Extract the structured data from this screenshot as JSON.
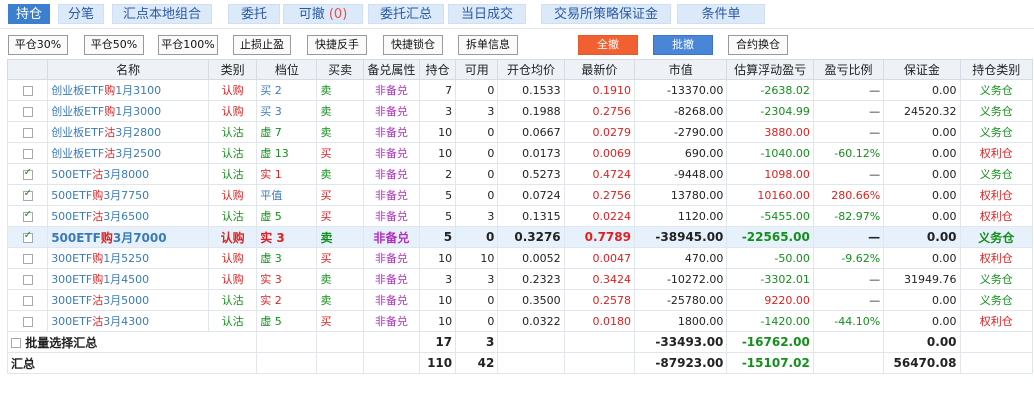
{
  "tabs": [
    {
      "label": "持仓",
      "active": true
    },
    {
      "label": "分笔"
    },
    {
      "label": "汇点本地组合"
    },
    {
      "label": "委托"
    },
    {
      "label": "可撤",
      "count": "(0)"
    },
    {
      "label": "委托汇总"
    },
    {
      "label": "当日成交"
    },
    {
      "label": "交易所策略保证金"
    },
    {
      "label": "条件单"
    }
  ],
  "toolbar": [
    "平仓30%",
    "平仓50%",
    "平仓100%",
    "止损止盈",
    "快捷反手",
    "快捷锁仓",
    "拆单信息",
    "全撤",
    "批撤",
    "合约换仓"
  ],
  "columns": [
    "名称",
    "类别",
    "档位",
    "买卖",
    "备兑属性",
    "持仓",
    "可用",
    "开仓均价",
    "最新价",
    "市值",
    "估算浮动盈亏",
    "盈亏比例",
    "保证金",
    "持仓类别"
  ],
  "rows": [
    {
      "checked": false,
      "name_a": "创业板ETF",
      "name_b": "购",
      "name_c": "1月3100",
      "type": "认购",
      "level": "买 2",
      "side": "卖",
      "cover": "非备兑",
      "pos": "7",
      "avail": "0",
      "open": "0.1533",
      "last": "0.1910",
      "mv": "-13370.00",
      "pnl": "-2638.02",
      "ratio": "—",
      "margin": "0.00",
      "cat": "义务仓"
    },
    {
      "checked": false,
      "name_a": "创业板ETF",
      "name_b": "购",
      "name_c": "1月3000",
      "type": "认购",
      "level": "买 3",
      "side": "卖",
      "cover": "非备兑",
      "pos": "3",
      "avail": "3",
      "open": "0.1988",
      "last": "0.2756",
      "mv": "-8268.00",
      "pnl": "-2304.99",
      "ratio": "—",
      "margin": "24520.32",
      "cat": "义务仓"
    },
    {
      "checked": false,
      "name_a": "创业板ETF",
      "name_b": "沽",
      "name_c": "3月2800",
      "type": "认沽",
      "level": "虚 7",
      "side": "卖",
      "cover": "非备兑",
      "pos": "10",
      "avail": "0",
      "open": "0.0667",
      "last": "0.0279",
      "mv": "-2790.00",
      "pnl": "3880.00",
      "ratio": "—",
      "margin": "0.00",
      "cat": "义务仓"
    },
    {
      "checked": false,
      "name_a": "创业板ETF",
      "name_b": "沽",
      "name_c": "3月2500",
      "type": "认沽",
      "level": "虚 13",
      "side": "买",
      "cover": "非备兑",
      "pos": "10",
      "avail": "0",
      "open": "0.0173",
      "last": "0.0069",
      "mv": "690.00",
      "pnl": "-1040.00",
      "ratio": "-60.12%",
      "margin": "0.00",
      "cat": "权利仓"
    },
    {
      "checked": true,
      "name_a": "500ETF",
      "name_b": "沽",
      "name_c": "3月8000",
      "type": "认沽",
      "level": "实 1",
      "side": "卖",
      "cover": "非备兑",
      "pos": "2",
      "avail": "0",
      "open": "0.5273",
      "last": "0.4724",
      "mv": "-9448.00",
      "pnl": "1098.00",
      "ratio": "—",
      "margin": "0.00",
      "cat": "义务仓"
    },
    {
      "checked": true,
      "name_a": "500ETF",
      "name_b": "购",
      "name_c": "3月7750",
      "type": "认购",
      "level": "平值",
      "side": "买",
      "cover": "非备兑",
      "pos": "5",
      "avail": "0",
      "open": "0.0724",
      "last": "0.2756",
      "mv": "13780.00",
      "pnl": "10160.00",
      "ratio": "280.66%",
      "margin": "0.00",
      "cat": "权利仓"
    },
    {
      "checked": true,
      "name_a": "500ETF",
      "name_b": "沽",
      "name_c": "3月6500",
      "type": "认沽",
      "level": "虚 5",
      "side": "买",
      "cover": "非备兑",
      "pos": "5",
      "avail": "3",
      "open": "0.1315",
      "last": "0.0224",
      "mv": "1120.00",
      "pnl": "-5455.00",
      "ratio": "-82.97%",
      "margin": "0.00",
      "cat": "权利仓"
    },
    {
      "checked": true,
      "selected": true,
      "name_a": "500ETF",
      "name_b": "购",
      "name_c": "3月7000",
      "type": "认购",
      "level": "实 3",
      "side": "卖",
      "cover": "非备兑",
      "pos": "5",
      "avail": "0",
      "open": "0.3276",
      "last": "0.7789",
      "mv": "-38945.00",
      "pnl": "-22565.00",
      "ratio": "—",
      "margin": "0.00",
      "cat": "义务仓"
    },
    {
      "checked": false,
      "name_a": "300ETF",
      "name_b": "购",
      "name_c": "1月5250",
      "type": "认购",
      "level": "虚 3",
      "side": "买",
      "cover": "非备兑",
      "pos": "10",
      "avail": "10",
      "open": "0.0052",
      "last": "0.0047",
      "mv": "470.00",
      "pnl": "-50.00",
      "ratio": "-9.62%",
      "margin": "0.00",
      "cat": "权利仓"
    },
    {
      "checked": false,
      "name_a": "300ETF",
      "name_b": "购",
      "name_c": "1月4500",
      "type": "认购",
      "level": "实 3",
      "side": "卖",
      "cover": "非备兑",
      "pos": "3",
      "avail": "3",
      "open": "0.2323",
      "last": "0.3424",
      "mv": "-10272.00",
      "pnl": "-3302.01",
      "ratio": "—",
      "margin": "31949.76",
      "cat": "义务仓"
    },
    {
      "checked": false,
      "name_a": "300ETF",
      "name_b": "沽",
      "name_c": "3月5000",
      "type": "认沽",
      "level": "实 2",
      "side": "卖",
      "cover": "非备兑",
      "pos": "10",
      "avail": "0",
      "open": "0.3500",
      "last": "0.2578",
      "mv": "-25780.00",
      "pnl": "9220.00",
      "ratio": "—",
      "margin": "0.00",
      "cat": "义务仓"
    },
    {
      "checked": false,
      "name_a": "300ETF",
      "name_b": "沽",
      "name_c": "3月4300",
      "type": "认沽",
      "level": "虚 5",
      "side": "买",
      "cover": "非备兑",
      "pos": "10",
      "avail": "0",
      "open": "0.0322",
      "last": "0.0180",
      "mv": "1800.00",
      "pnl": "-1420.00",
      "ratio": "-44.10%",
      "margin": "0.00",
      "cat": "权利仓"
    }
  ],
  "batch": {
    "label": "批量选择汇总",
    "pos": "17",
    "avail": "3",
    "mv": "-33493.00",
    "pnl": "-16762.00",
    "margin": "0.00"
  },
  "total": {
    "label": "汇总",
    "pos": "110",
    "avail": "42",
    "mv": "-87923.00",
    "pnl": "-15107.02",
    "margin": "56470.08"
  }
}
